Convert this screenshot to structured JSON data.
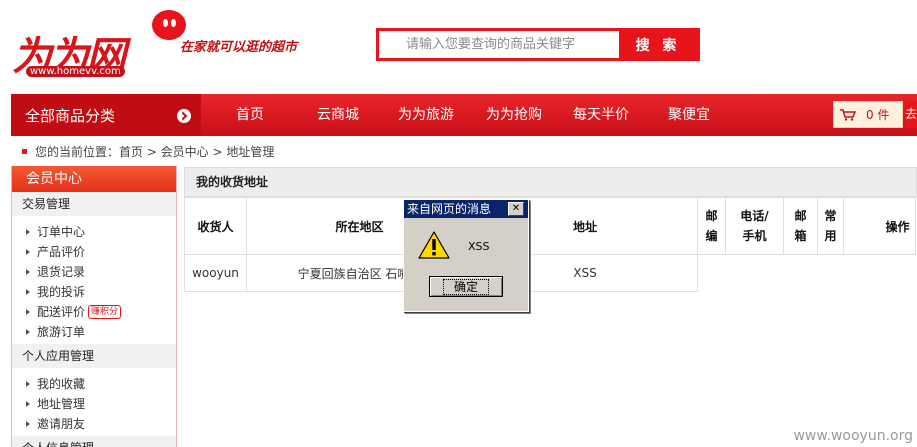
{
  "header": {
    "logo_text": "为为网",
    "logo_url": "www.homevv.com",
    "slogan": "在家就可以逛的超市",
    "search_placeholder": "请输入您要查询的商品关键字",
    "search_button": "搜 索"
  },
  "nav": {
    "category_label": "全部商品分类",
    "items": [
      "首页",
      "云商城",
      "为为旅游",
      "为为抢购",
      "每天半价",
      "聚便宜"
    ],
    "cart_label": "0 件",
    "cart_tail": "去"
  },
  "breadcrumb": "您的当前位置：首页 > 会员中心 > 地址管理",
  "sidebar": {
    "title": "会员中心",
    "groups": [
      {
        "title": "交易管理",
        "items": [
          "订单中心",
          "产品评价",
          "退货记录",
          "我的投诉",
          "配送评价",
          "旅游订单"
        ],
        "badge": "赚积分"
      },
      {
        "title": "个人应用管理",
        "items": [
          "我的收藏",
          "地址管理",
          "邀请朋友"
        ]
      }
    ],
    "cut_off_item": "个人信息管理"
  },
  "main": {
    "title": "我的收货地址",
    "columns": [
      "收货人",
      "所在地区",
      "地址",
      "邮编",
      "电话/手机",
      "邮箱",
      "常用",
      "操作"
    ],
    "row": {
      "name": "wooyun",
      "region": "宁夏回族自治区 石嘴山",
      "address": "XSS"
    }
  },
  "dialog": {
    "title": "来自网页的消息",
    "message": "XSS",
    "ok_button": "确定",
    "close_symbol": "✕"
  },
  "watermark": "www.wooyun.org",
  "colors": {
    "brand_red": "#e8141b",
    "dialog_title": "#0a246a",
    "dialog_bg": "#d4d0c8"
  }
}
